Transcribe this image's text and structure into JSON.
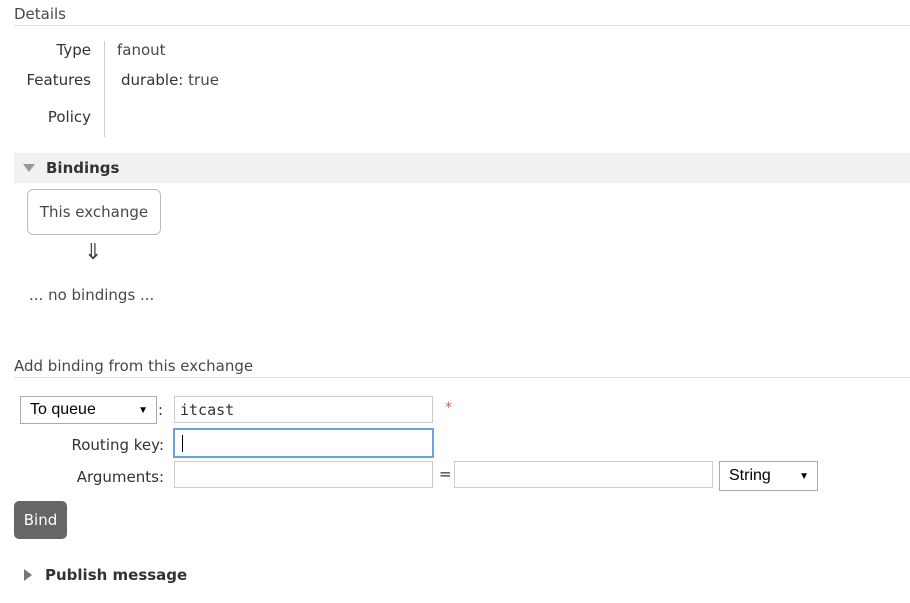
{
  "details": {
    "title": "Details",
    "rows": [
      {
        "label": "Type",
        "value": "fanout"
      },
      {
        "label": "Features",
        "key": "durable:",
        "value": "true"
      },
      {
        "label": "Policy",
        "value": ""
      }
    ]
  },
  "bindings": {
    "title": "Bindings",
    "exchange_box": "This exchange",
    "arrow": "⇓",
    "empty_text": "... no bindings ..."
  },
  "add_binding": {
    "title": "Add binding from this exchange",
    "destination_type": "To queue",
    "destination_value": "itcast",
    "required_mark": "*",
    "colon": ":",
    "routing_key_label": "Routing key:",
    "routing_key_value": "",
    "arguments_label": "Arguments:",
    "arg_key": "",
    "equals": "=",
    "arg_value": "",
    "arg_type": "String",
    "bind_button": "Bind"
  },
  "publish": {
    "title": "Publish message"
  },
  "icons": {
    "expanded": "triangle-down-icon",
    "collapsed": "triangle-right-icon",
    "select_caret": "caret-down-icon"
  },
  "colors": {
    "bar_background": "#f1f1f1",
    "button_background": "#666666",
    "focus_border": "#6ea3d9",
    "required": "#e05a5a"
  }
}
